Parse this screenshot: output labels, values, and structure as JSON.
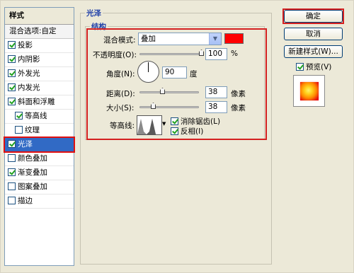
{
  "sidebar": {
    "header": "样式",
    "blend_item": "混合选项:自定",
    "items": [
      {
        "label": "投影",
        "checked": true
      },
      {
        "label": "内阴影",
        "checked": true
      },
      {
        "label": "外发光",
        "checked": true
      },
      {
        "label": "内发光",
        "checked": true
      },
      {
        "label": "斜面和浮雕",
        "checked": true
      },
      {
        "label": "等高线",
        "checked": true
      },
      {
        "label": "纹理",
        "checked": false
      },
      {
        "label": "光泽",
        "checked": true,
        "selected": true
      },
      {
        "label": "颜色叠加",
        "checked": false
      },
      {
        "label": "渐变叠加",
        "checked": true
      },
      {
        "label": "图案叠加",
        "checked": false
      },
      {
        "label": "描边",
        "checked": false
      }
    ]
  },
  "panel": {
    "group_title": "光泽",
    "structure_title": "结构",
    "blend_mode_label": "混合模式:",
    "blend_mode_value": "叠加",
    "color_swatch": "#ff0000",
    "opacity_label": "不透明度(O):",
    "opacity_value": "100",
    "opacity_unit": "%",
    "angle_label": "角度(N):",
    "angle_value": "90",
    "angle_unit": "度",
    "distance_label": "距离(D):",
    "distance_value": "38",
    "distance_unit": "像素",
    "size_label": "大小(S):",
    "size_value": "38",
    "size_unit": "像素",
    "contour_label": "等高线:",
    "antialias_label": "消除锯齿(L)",
    "antialias_checked": true,
    "invert_label": "反相(I)",
    "invert_checked": true
  },
  "buttons": {
    "ok": "确定",
    "cancel": "取消",
    "new_style": "新建样式(W)...",
    "preview_label": "预览(V)",
    "preview_checked": true
  },
  "colors": {
    "dialog_bg": "#ece9d8",
    "highlight_red": "#d42020",
    "selection_blue": "#316ac5",
    "title_blue": "#1f3fa8"
  }
}
